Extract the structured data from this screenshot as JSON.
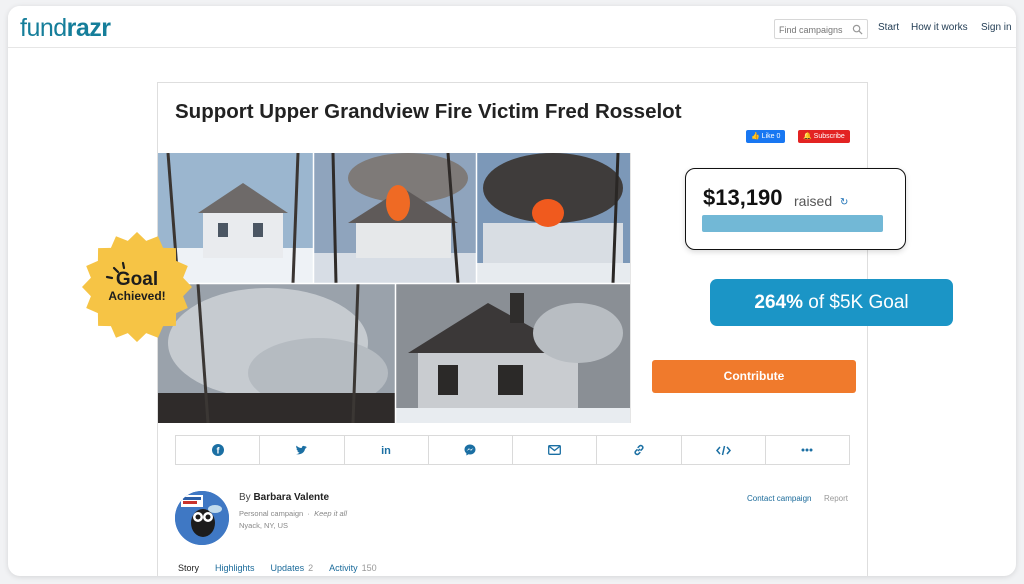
{
  "header": {
    "logo_part1": "fund",
    "logo_part2": "razr",
    "search_placeholder": "Find campaigns",
    "nav": [
      "Start",
      "How it works",
      "Sign in"
    ]
  },
  "campaign": {
    "title": "Support Upper Grandview Fire Victim Fred Rosselot",
    "like_label": "Like 0",
    "subscribe_label": "Subscribe",
    "contribute_label": "Contribute"
  },
  "fundraising": {
    "raised_amount": "$13,190",
    "raised_word": "raised",
    "goal_percent": "264%",
    "goal_text": "of $5K Goal",
    "progress_fraction": 1.0
  },
  "badge": {
    "line1": "Goal",
    "line2": "Achieved!"
  },
  "share": [
    "facebook-icon",
    "twitter-icon",
    "linkedin-icon",
    "messenger-icon",
    "email-icon",
    "link-icon",
    "embed-icon",
    "more-icon"
  ],
  "organizer": {
    "by": "By",
    "name": "Barbara Valente",
    "type": "Personal campaign",
    "keep": "Keep it all",
    "location": "Nyack, NY, US",
    "contact_label": "Contact campaign",
    "report_label": "Report"
  },
  "tabs": [
    {
      "label": "Story",
      "count": ""
    },
    {
      "label": "Highlights",
      "count": ""
    },
    {
      "label": "Updates",
      "count": "2"
    },
    {
      "label": "Activity",
      "count": "150"
    }
  ],
  "colors": {
    "brand": "#157e9a",
    "contribute": "#f07a2c",
    "goal_pill": "#1b95c6",
    "badge": "#f6c445"
  }
}
